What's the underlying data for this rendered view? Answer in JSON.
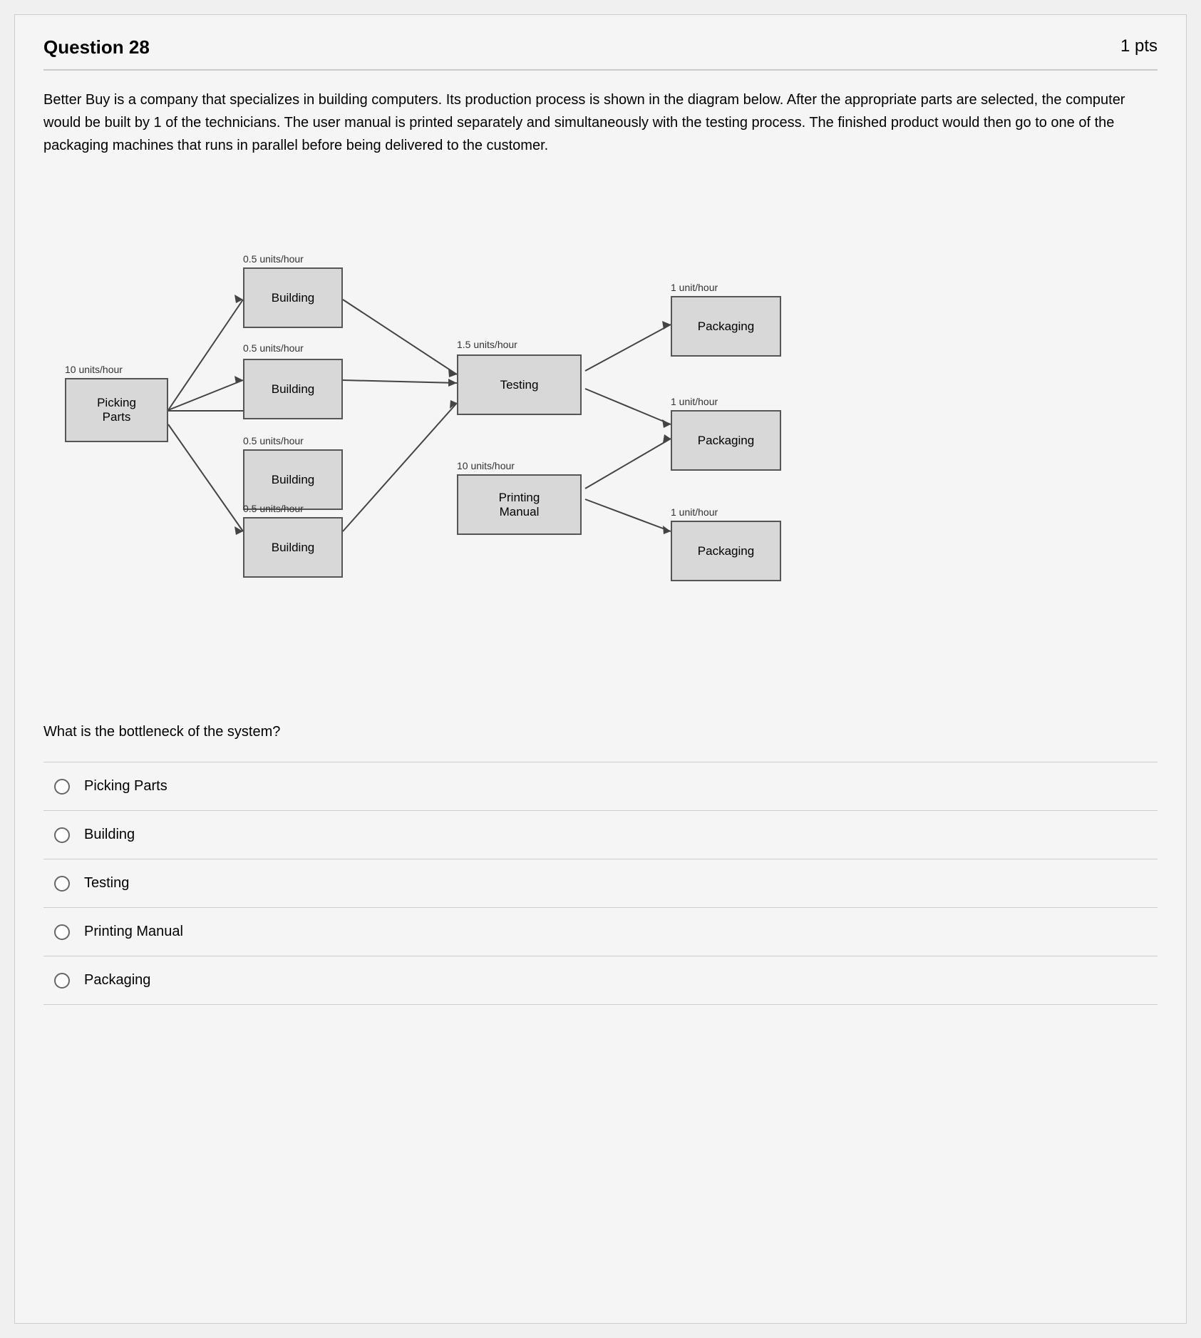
{
  "header": {
    "title": "Question 28",
    "pts": "1 pts"
  },
  "question_text": "Better Buy is a company that specializes in building computers. Its production process is shown in the diagram below. After the appropriate parts are selected, the computer would be built by 1 of the technicians. The user manual is printed separately and simultaneously with the testing process. The finished product would then go to one of the packaging machines that runs in parallel before being delivered to the customer.",
  "sub_question": "What is the bottleneck of the system?",
  "diagram": {
    "nodes": {
      "picking_parts": {
        "label": "Picking\nParts",
        "rate": "10 units/hour"
      },
      "building1": {
        "label": "Building",
        "rate": "0.5 units/hour"
      },
      "building2": {
        "label": "Building",
        "rate": "0.5 units/hour"
      },
      "building3": {
        "label": "Building",
        "rate": "0.5 units/hour"
      },
      "building4": {
        "label": "Building",
        "rate": "0.5 units/hour"
      },
      "testing": {
        "label": "Testing",
        "rate": "1.5 units/hour"
      },
      "printing_manual": {
        "label": "Printing\nManual",
        "rate": "10 units/hour"
      },
      "packaging1": {
        "label": "Packaging",
        "rate": "1 unit/hour"
      },
      "packaging2": {
        "label": "Packaging",
        "rate": "1 unit/hour"
      },
      "packaging3": {
        "label": "Packaging",
        "rate": "1 unit/hour"
      }
    }
  },
  "answers": [
    {
      "id": "picking-parts",
      "label": "Picking Parts"
    },
    {
      "id": "building",
      "label": "Building"
    },
    {
      "id": "testing",
      "label": "Testing"
    },
    {
      "id": "printing-manual",
      "label": "Printing Manual"
    },
    {
      "id": "packaging",
      "label": "Packaging"
    }
  ]
}
